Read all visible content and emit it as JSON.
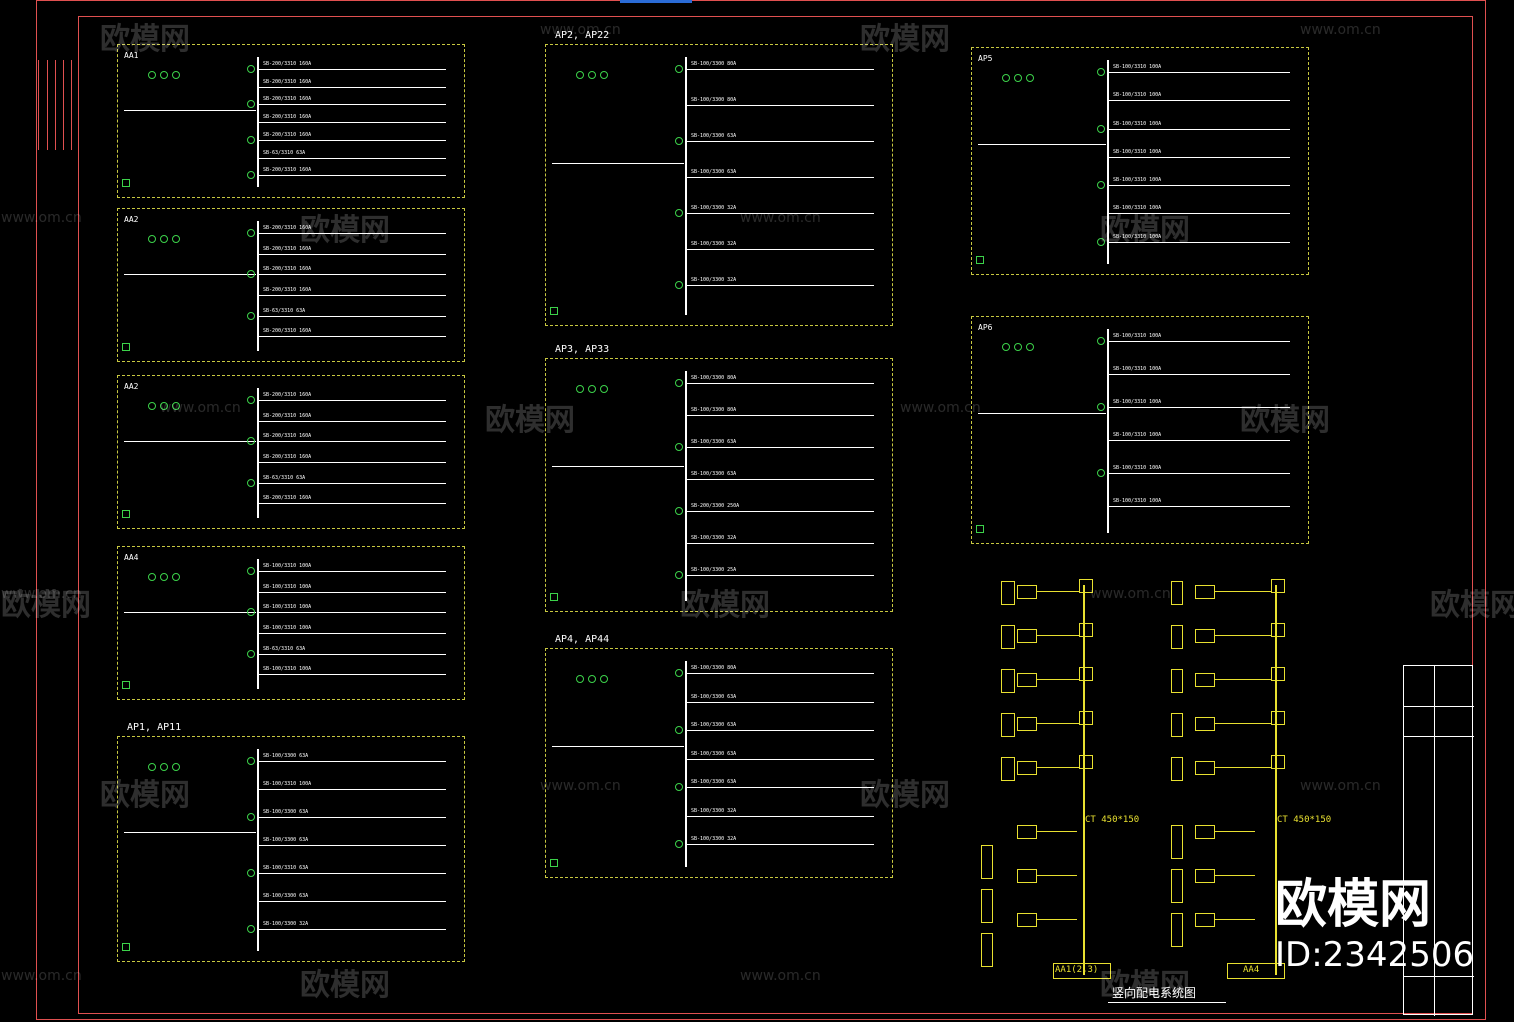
{
  "drawing": {
    "panels": [
      {
        "id": "aa1",
        "title": "AA1",
        "feeders": [
          "SB-200/3310 160A",
          "SB-200/3310 160A",
          "SB-200/3310 160A",
          "SB-200/3310 160A",
          "SB-200/3310 160A",
          "SB-63/3310 63A",
          "SB-200/3310 160A"
        ]
      },
      {
        "id": "aa2a",
        "title": "AA2",
        "feeders": [
          "SB-200/3310 160A",
          "SB-200/3310 160A",
          "SB-200/3310 160A",
          "SB-200/3310 160A",
          "SB-63/3310 63A",
          "SB-200/3310 160A"
        ]
      },
      {
        "id": "aa2b",
        "title": "AA2",
        "feeders": [
          "SB-200/3310 160A",
          "SB-200/3310 160A",
          "SB-200/3310 160A",
          "SB-200/3310 160A",
          "SB-63/3310 63A",
          "SB-200/3310 160A"
        ]
      },
      {
        "id": "aa4",
        "title": "AA4",
        "feeders": [
          "SB-100/3310 100A",
          "SB-100/3310 100A",
          "SB-100/3310 100A",
          "SB-100/3310 100A",
          "SB-63/3310 63A",
          "SB-100/3310 100A"
        ]
      },
      {
        "id": "ap1",
        "title": "AP1, AP11",
        "feeders": [
          "SB-100/3300 63A",
          "SB-100/3310 100A",
          "SB-100/3300 63A",
          "SB-100/3300 63A",
          "SB-100/3310 63A",
          "SB-100/3300 63A",
          "SB-100/3300 32A"
        ]
      },
      {
        "id": "ap2",
        "title": "AP2, AP22",
        "feeders": [
          "SB-100/3300 80A",
          "SB-100/3300 80A",
          "SB-100/3300 63A",
          "SB-100/3300 63A",
          "SB-100/3300 32A",
          "SB-100/3300 32A",
          "SB-100/3300 32A"
        ]
      },
      {
        "id": "ap3",
        "title": "AP3, AP33",
        "feeders": [
          "SB-100/3300 80A",
          "SB-100/3300 80A",
          "SB-100/3300 63A",
          "SB-100/3300 63A",
          "SB-200/3300 250A",
          "SB-100/3300 32A",
          "SB-100/3300 25A"
        ]
      },
      {
        "id": "ap4",
        "title": "AP4, AP44",
        "feeders": [
          "SB-100/3300 80A",
          "SB-100/3300 63A",
          "SB-100/3300 63A",
          "SB-100/3300 63A",
          "SB-100/3300 63A",
          "SB-100/3300 32A",
          "SB-100/3300 32A"
        ]
      },
      {
        "id": "ap5",
        "title": "AP5",
        "feeders": [
          "SB-100/3310 100A",
          "SB-100/3310 100A",
          "SB-100/3310 100A",
          "SB-100/3310 100A",
          "SB-100/3310 100A",
          "SB-100/3310 100A",
          "SB-100/3310 100A"
        ]
      },
      {
        "id": "ap6",
        "title": "AP6",
        "feeders": [
          "SB-100/3310 100A",
          "SB-100/3310 100A",
          "SB-100/3310 100A",
          "SB-100/3310 100A",
          "SB-100/3310 100A",
          "SB-100/3310 100A"
        ]
      }
    ],
    "riser_labels": {
      "bottom_left": "AA1(2,3)",
      "bottom_right": "AA4",
      "ct_left": "CT 450*150",
      "ct_right": "CT 450*150"
    },
    "caption": "竖向配电系统图"
  },
  "watermarks": {
    "brand": "欧模网",
    "url": "www.om.cn",
    "id_text": "ID:2342506"
  },
  "colors": {
    "frame": "#e05050",
    "panel_border": "#c8c840",
    "device": "#3cd24a",
    "riser": "#e8e030"
  }
}
